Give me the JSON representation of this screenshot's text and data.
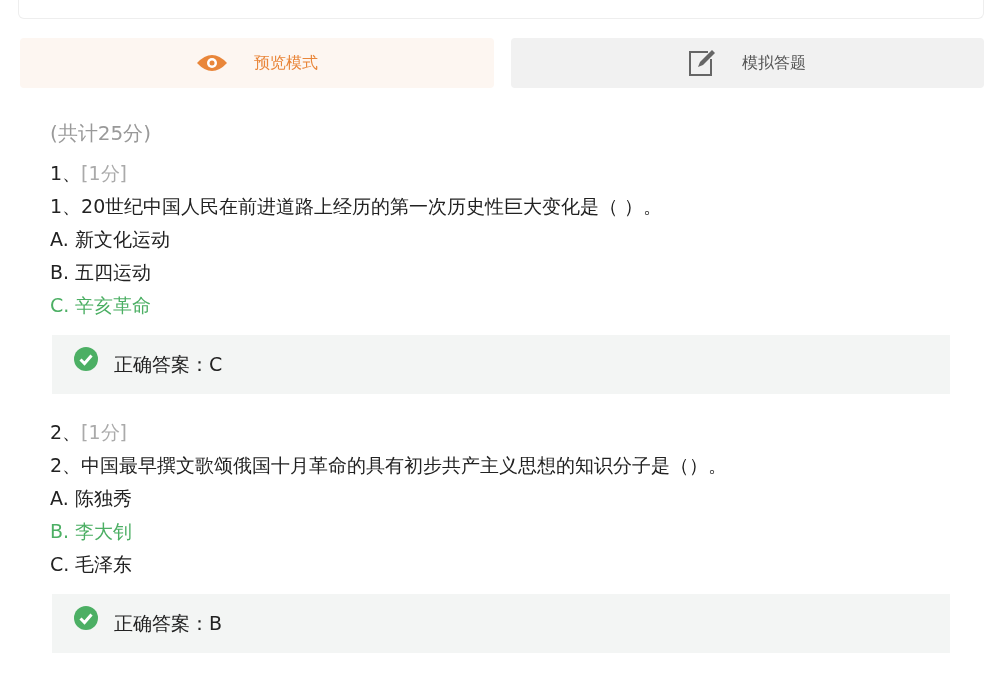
{
  "tabs": [
    {
      "label": "预览模式",
      "kind": "preview",
      "selected": true
    },
    {
      "label": "模拟答题",
      "kind": "practice",
      "selected": false
    }
  ],
  "total": "(共计25分)",
  "questions": [
    {
      "number": "1、",
      "score": "[1分]",
      "text": "1、20世纪中国人民在前进道路上经历的第一次历史性巨大变化是（   ）。",
      "options": [
        {
          "text": "A. 新文化运动",
          "correct": false
        },
        {
          "text": "B. 五四运动",
          "correct": false
        },
        {
          "text": "C. 辛亥革命",
          "correct": true
        }
      ],
      "answer": "正确答案：C"
    },
    {
      "number": "2、",
      "score": "[1分]",
      "text": "2、中国最早撰文歌颂俄国十月革命的具有初步共产主义思想的知识分子是（）。",
      "options": [
        {
          "text": "A. 陈独秀",
          "correct": false
        },
        {
          "text": "B. 李大钊",
          "correct": true
        },
        {
          "text": "C. 毛泽东",
          "correct": false
        }
      ],
      "answer": "正确答案：B"
    }
  ]
}
